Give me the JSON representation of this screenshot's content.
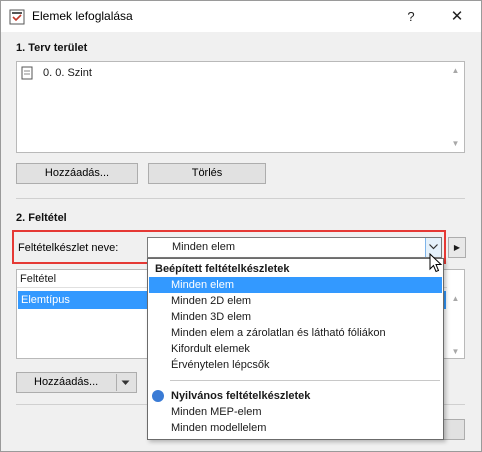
{
  "window": {
    "title": "Elemek lefoglalása",
    "help_label": "?",
    "close_label": "✕"
  },
  "section1": {
    "heading": "1. Terv terület",
    "items": [
      "0. 0. Szint"
    ],
    "add_button": "Hozzáadás...",
    "delete_button": "Törlés"
  },
  "section2": {
    "heading": "2. Feltétel",
    "set_name_label": "Feltételkészlet neve:",
    "set_name_value": "Minden elem",
    "list_header": "Feltétel",
    "list_items": [
      "Elemtípus"
    ],
    "add_button": "Hozzáadás..."
  },
  "dropdown": {
    "builtin_header": "Beépített feltételkészletek",
    "builtin_items": [
      "Minden elem",
      "Minden 2D elem",
      "Minden 3D elem",
      "Minden elem a zárolatlan és látható fóliákon",
      "Kifordult elemek",
      "Érvénytelen lépcsők"
    ],
    "selected_index": 0,
    "public_header": "Nyilvános feltételkészletek",
    "public_items": [
      "Minden MEP-elem",
      "Minden modellelem"
    ]
  },
  "colors": {
    "selection": "#3399ff",
    "highlight_frame": "#e53935",
    "public_dot": "#3a7bd5"
  }
}
